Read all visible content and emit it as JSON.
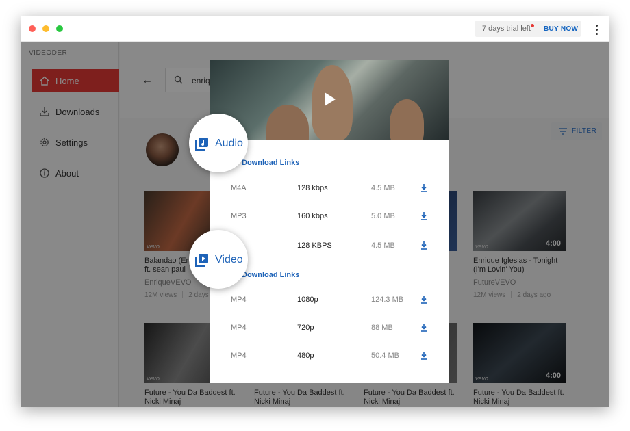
{
  "titlebar": {
    "trial_text": "7 days trial left",
    "buy_label": "BUY NOW",
    "dot_colors": [
      "#ff5f57",
      "#febc2e",
      "#28c840"
    ]
  },
  "sidebar": {
    "brand": "VIDEODER",
    "items": [
      {
        "label": "Home",
        "icon": "home-icon",
        "active": true
      },
      {
        "label": "Downloads",
        "icon": "download-tray-icon",
        "active": false
      },
      {
        "label": "Settings",
        "icon": "gear-icon",
        "active": false
      },
      {
        "label": "About",
        "icon": "info-icon",
        "active": false
      }
    ]
  },
  "search": {
    "query": "enriq"
  },
  "filter_label": "FILTER",
  "cards": [
    {
      "title": "Balandao (En",
      "title2": "ft. sean paul",
      "channel": "EnriqueVEVO",
      "views": "12M views",
      "age": "2 days",
      "duration": ""
    },
    {
      "title": "Enrique Iglesias - Tonight",
      "title2": "(I'm Lovin' You)",
      "channel": "FutureVEVO",
      "views": "12M views",
      "age": "2 days ago",
      "duration": "4:00"
    },
    {
      "title": "Future - You Da Baddest ft.",
      "title2": "Nicki Minaj",
      "channel": "",
      "views": "",
      "age": "",
      "duration": ""
    },
    {
      "title": "Future - You Da Baddest ft.",
      "title2": "Nicki Minaj",
      "channel": "",
      "views": "",
      "age": "",
      "duration": ""
    },
    {
      "title": "Future - You Da Baddest ft.",
      "title2": "Nicki Minaj",
      "channel": "",
      "views": "",
      "age": "",
      "duration": ""
    },
    {
      "title": "Future - You Da Baddest ft.",
      "title2": "Nicki Minaj",
      "channel": "",
      "views": "",
      "age": "",
      "duration": "4:00"
    }
  ],
  "modal": {
    "audio_section": "Download Links",
    "video_section": "Download Links",
    "audio_rows": [
      {
        "format": "M4A",
        "quality": "128 kbps",
        "size": "4.5 MB"
      },
      {
        "format": "MP3",
        "quality": "160 kbps",
        "size": "5.0 MB"
      },
      {
        "format": "",
        "quality": "128 KBPS",
        "size": "4.5 MB"
      }
    ],
    "video_rows": [
      {
        "format": "MP4",
        "quality": "1080p",
        "size": "124.3 MB"
      },
      {
        "format": "MP4",
        "quality": "720p",
        "size": "88 MB"
      },
      {
        "format": "MP4",
        "quality": "480p",
        "size": "50.4 MB"
      }
    ]
  },
  "callouts": {
    "audio": "Audio",
    "video": "Video"
  },
  "thumb_badge": "vevo",
  "colors": {
    "accent_red": "#e53935",
    "link_blue": "#1e63b8"
  }
}
